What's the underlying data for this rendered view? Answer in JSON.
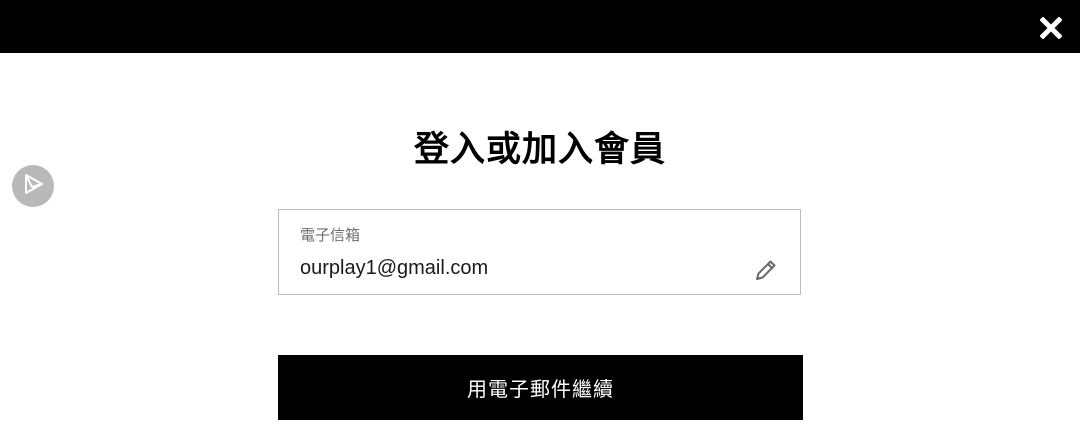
{
  "header": {
    "close_icon": "close-icon"
  },
  "floating_action": {
    "icon": "send-arrow-icon",
    "color": "#b9b9b9"
  },
  "main": {
    "title": "登入或加入會員",
    "email_field": {
      "label": "電子信箱",
      "value": "ourplay1@gmail.com",
      "edit_icon": "pencil-icon"
    },
    "continue_button": {
      "label": "用電子郵件繼續"
    }
  },
  "colors": {
    "topbar": "#000000",
    "button_bg": "#000000",
    "button_text": "#ffffff",
    "field_border": "#bdbdbd"
  }
}
